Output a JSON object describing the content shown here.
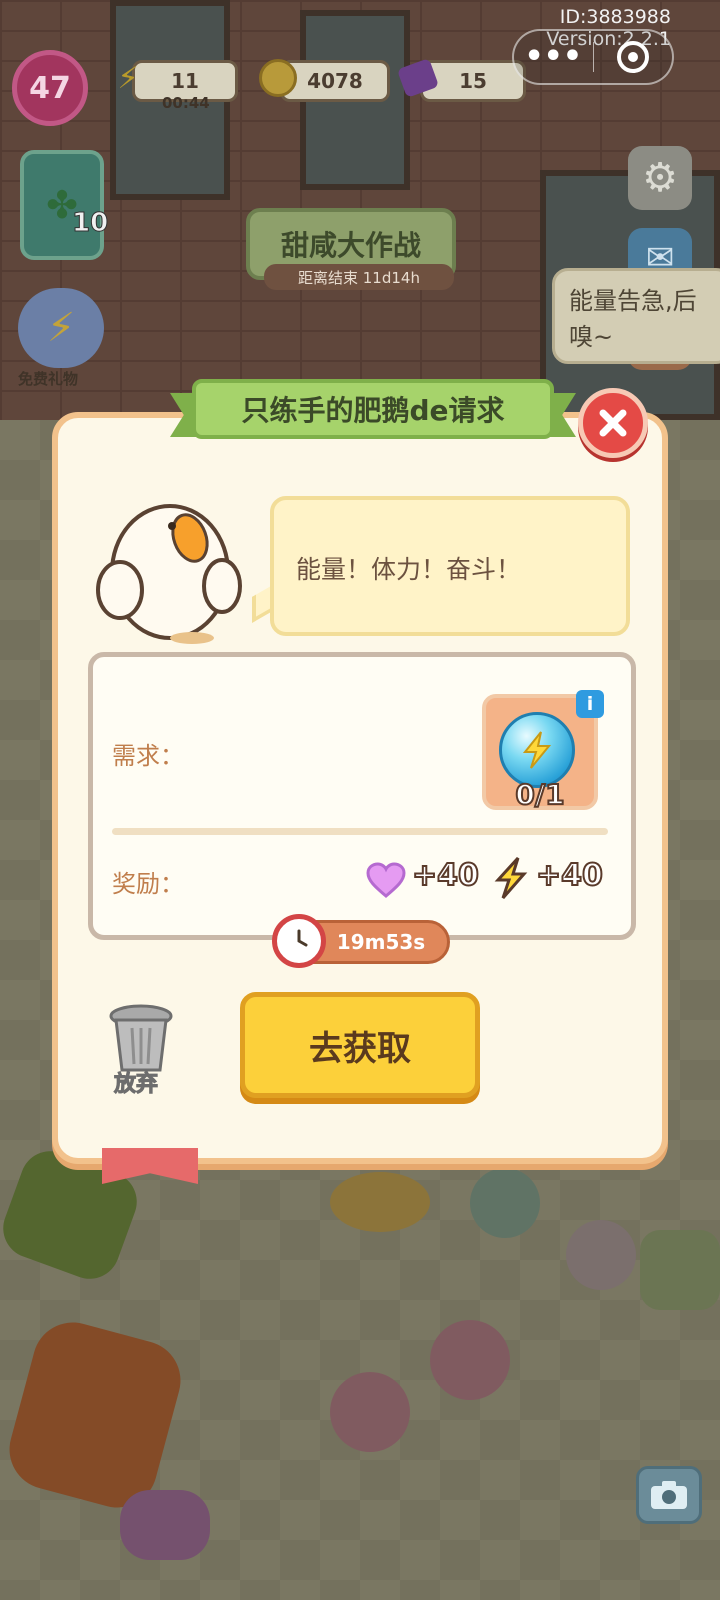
{
  "system": {
    "id_text": "ID:3883988",
    "version_text": "Version:2.2.1"
  },
  "hud": {
    "level": "47",
    "energy": "11",
    "energy_timer": "00:44",
    "coins": "4078",
    "gems": "15"
  },
  "side": {
    "clipboard_count": "10",
    "free_gift_label": "免费礼物",
    "event_title": "甜咸大作战",
    "event_countdown": "距离结束 11d14h",
    "tip_text": "能量告急,后 嗅~"
  },
  "modal": {
    "title": "只练手的肥鹅de请求",
    "speech": "能量！体力！奋斗！",
    "requirement_label": "需求：",
    "requirement_count": "0/1",
    "reward_label": "奖励：",
    "reward_heart": "+40",
    "reward_energy": "+40",
    "timer": "19m53s",
    "abandon_label": "放弃",
    "go_button": "去获取"
  },
  "colors": {
    "ribbon": "#a6d36b",
    "close": "#e44a46",
    "go_button": "#fcd03a",
    "panel_border": "#f2c28c"
  }
}
